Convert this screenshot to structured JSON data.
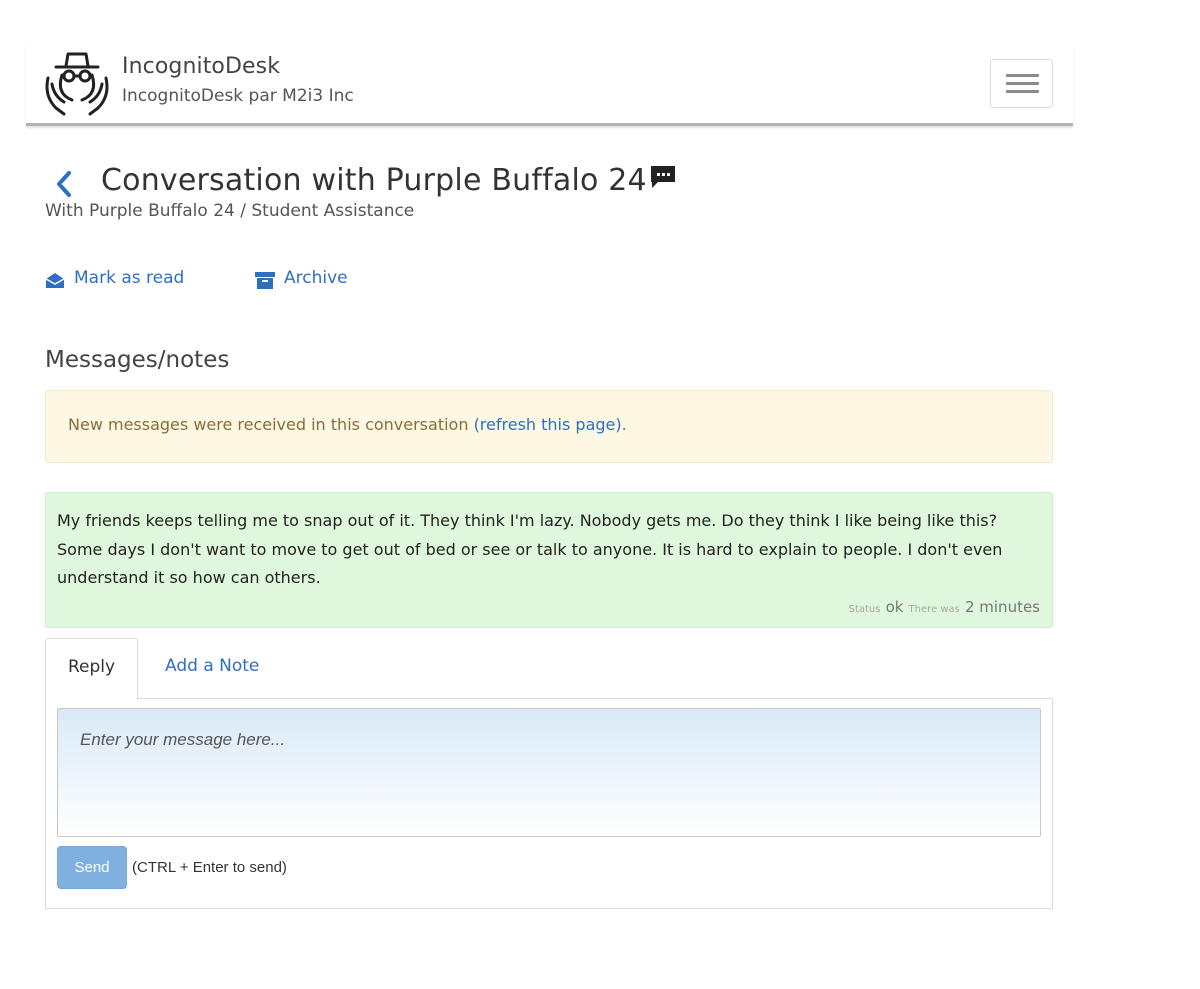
{
  "header": {
    "brand_title": "IncognitoDesk",
    "brand_subtitle": "IncognitoDesk par M2i3 Inc",
    "logo_icon": "incognito-hands-icon",
    "menu_icon": "hamburger-menu-icon"
  },
  "conversation": {
    "title": "Conversation with Purple Buffalo 24",
    "subtitle": "With Purple Buffalo 24 / Student Assistance",
    "back_icon": "chevron-left-icon",
    "title_icon": "chat-bubble-icon"
  },
  "actions": {
    "mark_as_read": "Mark as read",
    "archive": "Archive"
  },
  "messages_section": {
    "title": "Messages/notes",
    "alert_text": "New messages were received in this conversation ",
    "alert_link": "(refresh this page)",
    "alert_suffix": "."
  },
  "message": {
    "text": "My friends keeps telling me to snap out of it. They think I'm lazy. Nobody gets me. Do they think I like being like this? Some days I don't want to move to get out of bed or see or talk to anyone. It is hard to explain to people. I don't even understand it so how can others.",
    "status_label": "Status",
    "status_value": "ok",
    "time_label": "There was",
    "time_value": "2 minutes"
  },
  "reply": {
    "tabs": [
      "Reply",
      "Add a Note"
    ],
    "placeholder": "Enter your message here...",
    "send_label": "Send",
    "send_hint": "(CTRL + Enter to send)"
  },
  "colors": {
    "link": "#2e6fbf",
    "alert_bg": "#fcf8e3",
    "message_bg": "#dff7dc",
    "send_button": "#7fb0e0"
  }
}
